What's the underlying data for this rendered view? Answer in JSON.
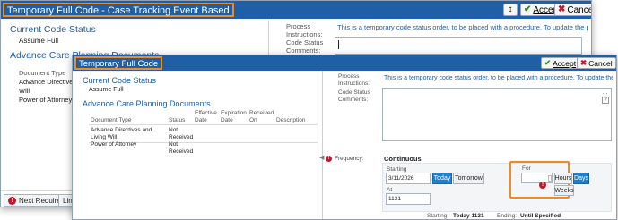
{
  "back_window": {
    "title": "Temporary Full Code - Case Tracking Event Based",
    "toolbar": {
      "pin_icon": "pin-icon",
      "accept_label": "Accept",
      "cancel_label": "Cancel"
    },
    "left": {
      "current_code_status_heading": "Current Code Status",
      "current_code_status_value": "Assume Full",
      "acp_heading": "Advance Care Planning Documents",
      "doc_type_header": "Document Type",
      "rows": [
        "Advance Directives and Living",
        "Will",
        "Power of Attorney"
      ]
    },
    "right": {
      "process_instructions_label": "Process Instructions:",
      "process_instructions_text": "This is a temporary code status order, to be placed with a procedure. To update the p...",
      "code_status_comments_label": "Code Status Comments:"
    },
    "footer": {
      "next_required_label": "Next Required",
      "link_label": "Link"
    }
  },
  "front_window": {
    "title": "Temporary Full Code",
    "toolbar": {
      "accept_label": "Accept",
      "cancel_label": "Cancel"
    },
    "left": {
      "current_code_status_heading": "Current Code Status",
      "current_code_status_value": "Assume Full",
      "acp_heading": "Advance Care Planning Documents",
      "columns": [
        "Document Type",
        "Status",
        "Effective Date",
        "Expiration Date",
        "Received On",
        "Description"
      ],
      "rows": [
        {
          "type": "Advance Directives and Living Will",
          "status": "Not Received"
        },
        {
          "type": "Power of Attorney",
          "status": "Not Received"
        }
      ]
    },
    "right": {
      "process_instructions_label": "Process Instructions:",
      "process_instructions_text": "This is a temporary code status order, to be placed with a procedure. To update the p...",
      "code_status_comments_label": "Code Status Comments:",
      "frequency_label": "Frequency:",
      "frequency_value": "Continuous",
      "starting_label": "Starting",
      "starting_date": "3/11/2026",
      "today_button": "Today",
      "tomorrow_button": "Tomorrow",
      "at_label": "At",
      "at_time": "1131",
      "for_label": "For",
      "hours_button": "Hours",
      "days_button": "Days",
      "weeks_button": "Weeks",
      "summary_starting_label": "Starting:",
      "summary_starting_value": "Today 1131",
      "summary_ending_label": "Ending:",
      "summary_ending_value": "Until Specified"
    }
  },
  "colors": {
    "titlebar": "#1f5fa6",
    "highlight": "#f08a24",
    "accent_blue": "#1f7fd0",
    "error_red": "#c0182a",
    "accept_green": "#2b8a1e"
  }
}
